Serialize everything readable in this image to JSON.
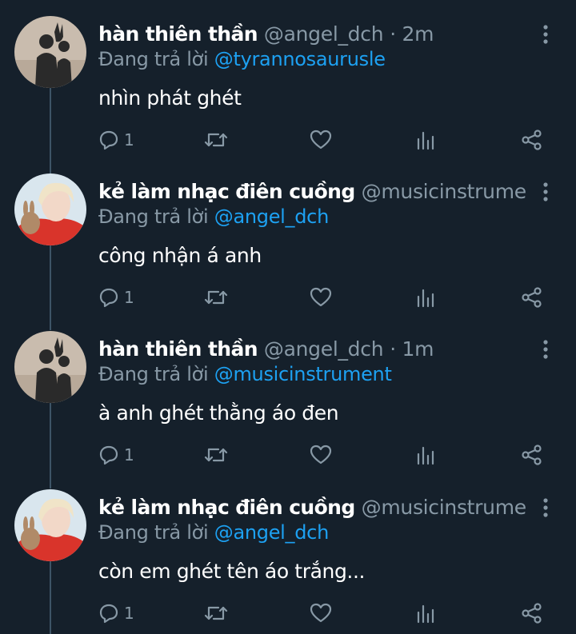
{
  "tweets": [
    {
      "name": "hàn thiên thần",
      "handle": "@angel_dch",
      "time": "· 2m",
      "reply_prefix": "Đang trả lời",
      "reply_to": "@tyrannosaurusle",
      "text": "nhìn phát ghét",
      "reply_count": "1",
      "avatar": "silhouette-avatar"
    },
    {
      "name": "kẻ làm nhạc điên cuồng",
      "handle": "@musicinstrument ...",
      "time": "",
      "reply_prefix": "Đang trả lời",
      "reply_to": "@angel_dch",
      "text": "công nhận á anh",
      "reply_count": "1",
      "avatar": "person-with-rabbit-avatar"
    },
    {
      "name": "hàn thiên thần",
      "handle": "@angel_dch",
      "time": "· 1m",
      "reply_prefix": "Đang trả lời",
      "reply_to": "@musicinstrument",
      "text": "à anh ghét thằng áo đen",
      "reply_count": "1",
      "avatar": "silhouette-avatar"
    },
    {
      "name": "kẻ làm nhạc điên cuồng",
      "handle": "@musicinstrument ...",
      "time": "",
      "reply_prefix": "Đang trả lời",
      "reply_to": "@angel_dch",
      "text": "còn em ghét tên áo trắng...",
      "reply_count": "1",
      "avatar": "person-with-rabbit-avatar"
    }
  ],
  "colors": {
    "background": "#15202b",
    "mention": "#1da1f2",
    "muted": "#8899a6",
    "thread_line": "#3d5466"
  },
  "icons": [
    "reply-icon",
    "retweet-icon",
    "like-icon",
    "analytics-icon",
    "share-icon",
    "more-icon"
  ]
}
